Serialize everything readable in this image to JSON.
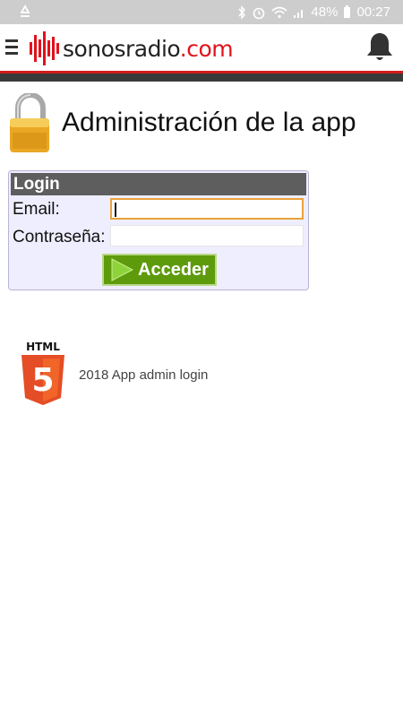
{
  "status_bar": {
    "battery": "48%",
    "time": "00:27",
    "icons": [
      "recycle-icon",
      "bluetooth-icon",
      "alarm-icon",
      "wifi-icon",
      "signal-icon",
      "battery-icon"
    ]
  },
  "header": {
    "logo_main": "sonosradio",
    "logo_domain": ".com",
    "icons": [
      "menu-icon",
      "bell-icon"
    ]
  },
  "page": {
    "title": "Administración de la app"
  },
  "login": {
    "header": "Login",
    "email_label": "Email:",
    "email_value": "",
    "password_label": "Contraseña:",
    "password_value": "",
    "submit_label": "Acceder"
  },
  "footer": {
    "badge_text": "HTML",
    "badge_number": "5",
    "text": "2018 App admin login"
  },
  "colors": {
    "status_bar": "#cdcdcd",
    "brand_red": "#e0121b",
    "dark_bar": "#3a3a3a",
    "login_bg": "#efeefe",
    "button_green": "#5e9b0c",
    "html5_orange": "#e44d26"
  }
}
